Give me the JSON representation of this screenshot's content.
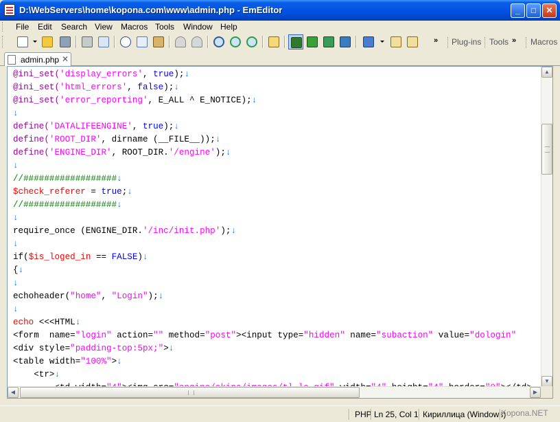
{
  "window": {
    "title": "D:\\WebServers\\home\\kopona.com\\www\\admin.php - EmEditor",
    "minimize": "_",
    "maximize": "□",
    "close": "✕"
  },
  "menu": {
    "items": [
      {
        "label": "File"
      },
      {
        "label": "Edit"
      },
      {
        "label": "Search"
      },
      {
        "label": "View"
      },
      {
        "label": "Macros"
      },
      {
        "label": "Tools"
      },
      {
        "label": "Window"
      },
      {
        "label": "Help"
      }
    ]
  },
  "toolbar": {
    "buttons": [
      "new-file-icon",
      "open-file-icon",
      "save-icon",
      "print-icon",
      "print-preview-icon",
      "cut-icon",
      "copy-icon",
      "paste-icon",
      "undo-icon",
      "redo-icon",
      "find-icon",
      "find-next-icon",
      "find-previous-icon",
      "find-in-files-icon",
      "show-outline-icon",
      "word-wrap-icon",
      "refresh-icon",
      "browser-icon",
      "configuration-icon",
      "properties-icon",
      "customize-icon"
    ],
    "overflow": "»",
    "plugins_label": "Plug-ins",
    "tools_label": "Tools",
    "macros_label": "Macros"
  },
  "tab": {
    "label": "admin.php",
    "close": "✕"
  },
  "editor": {
    "eol_marker": "↓",
    "lines": [
      [
        {
          "t": "@ini_set(",
          "c": "fn"
        },
        {
          "t": "'display_errors'",
          "c": "str"
        },
        {
          "t": ", ",
          "c": "black"
        },
        {
          "t": "true",
          "c": "blue"
        },
        {
          "t": ");",
          "c": "black"
        }
      ],
      [
        {
          "t": "@ini_set(",
          "c": "fn"
        },
        {
          "t": "'html_errors'",
          "c": "str"
        },
        {
          "t": ", ",
          "c": "black"
        },
        {
          "t": "false",
          "c": "blue"
        },
        {
          "t": ");",
          "c": "black"
        }
      ],
      [
        {
          "t": "@ini_set(",
          "c": "fn"
        },
        {
          "t": "'error_reporting'",
          "c": "str"
        },
        {
          "t": ", E_ALL ^ E_NOTICE);",
          "c": "black"
        }
      ],
      [],
      [
        {
          "t": "define(",
          "c": "fn"
        },
        {
          "t": "'DATALIFEENGINE'",
          "c": "str"
        },
        {
          "t": ", ",
          "c": "black"
        },
        {
          "t": "true",
          "c": "blue"
        },
        {
          "t": ");",
          "c": "black"
        }
      ],
      [
        {
          "t": "define(",
          "c": "fn"
        },
        {
          "t": "'ROOT_DIR'",
          "c": "str"
        },
        {
          "t": ", dirname (__FILE__));",
          "c": "black"
        }
      ],
      [
        {
          "t": "define(",
          "c": "fn"
        },
        {
          "t": "'ENGINE_DIR'",
          "c": "str"
        },
        {
          "t": ", ROOT_DIR.",
          "c": "black"
        },
        {
          "t": "'/engine'",
          "c": "str"
        },
        {
          "t": ");",
          "c": "black"
        }
      ],
      [],
      [
        {
          "t": "//##################",
          "c": "cmt"
        }
      ],
      [
        {
          "t": "$check_referer",
          "c": "var"
        },
        {
          "t": " = ",
          "c": "black"
        },
        {
          "t": "true",
          "c": "blue"
        },
        {
          "t": ";",
          "c": "black"
        }
      ],
      [
        {
          "t": "//##################",
          "c": "cmt"
        }
      ],
      [],
      [
        {
          "t": "require_once (ENGINE_DIR.",
          "c": "black"
        },
        {
          "t": "'/inc/init.php'",
          "c": "str"
        },
        {
          "t": ");",
          "c": "black"
        }
      ],
      [],
      [
        {
          "t": "if(",
          "c": "black"
        },
        {
          "t": "$is_loged_in",
          "c": "var"
        },
        {
          "t": " == ",
          "c": "black"
        },
        {
          "t": "FALSE",
          "c": "blue"
        },
        {
          "t": ")",
          "c": "black"
        }
      ],
      [
        {
          "t": "{",
          "c": "black"
        }
      ],
      [],
      [
        {
          "t": "echoheader(",
          "c": "black"
        },
        {
          "t": "\"home\"",
          "c": "str"
        },
        {
          "t": ", ",
          "c": "black"
        },
        {
          "t": "\"Login\"",
          "c": "str"
        },
        {
          "t": ");",
          "c": "black"
        }
      ],
      [],
      [
        {
          "t": "echo",
          "c": "var"
        },
        {
          "t": " <<<HTML",
          "c": "black"
        }
      ],
      [
        {
          "t": "<form  name=",
          "c": "black"
        },
        {
          "t": "\"login\"",
          "c": "str"
        },
        {
          "t": " action=",
          "c": "black"
        },
        {
          "t": "\"\"",
          "c": "str"
        },
        {
          "t": " method=",
          "c": "black"
        },
        {
          "t": "\"post\"",
          "c": "str"
        },
        {
          "t": "><input type=",
          "c": "black"
        },
        {
          "t": "\"hidden\"",
          "c": "str"
        },
        {
          "t": " name=",
          "c": "black"
        },
        {
          "t": "\"subaction\"",
          "c": "str"
        },
        {
          "t": " value=",
          "c": "black"
        },
        {
          "t": "\"dologin\"",
          "c": "str"
        }
      ],
      [
        {
          "t": "<div style=",
          "c": "black"
        },
        {
          "t": "\"padding-top:5px;\"",
          "c": "str"
        },
        {
          "t": ">",
          "c": "black"
        }
      ],
      [
        {
          "t": "<table width=",
          "c": "black"
        },
        {
          "t": "\"100%\"",
          "c": "str"
        },
        {
          "t": ">",
          "c": "black"
        }
      ],
      [
        {
          "t": "    <tr>",
          "c": "black"
        }
      ],
      [
        {
          "t": "        <td width=",
          "c": "black"
        },
        {
          "t": "\"4\"",
          "c": "str"
        },
        {
          "t": "><img src=",
          "c": "black"
        },
        {
          "t": "\"engine/skins/images/tl_lo.gif\"",
          "c": "str"
        },
        {
          "t": " width=",
          "c": "black"
        },
        {
          "t": "\"4\"",
          "c": "str"
        },
        {
          "t": " height=",
          "c": "black"
        },
        {
          "t": "\"4\"",
          "c": "str"
        },
        {
          "t": " border=",
          "c": "black"
        },
        {
          "t": "\"0\"",
          "c": "str"
        },
        {
          "t": "></td>",
          "c": "black"
        }
      ]
    ],
    "eol_hidden_lines": [
      20,
      24
    ]
  },
  "scrollbars": {
    "up": "▲",
    "down": "▼",
    "left": "◀",
    "right": "▶"
  },
  "status": {
    "mode": "PHP",
    "position": "Ln 25, Col 1",
    "encoding": "Кириллица (Windows)",
    "watermark": "Kopona.NET"
  }
}
